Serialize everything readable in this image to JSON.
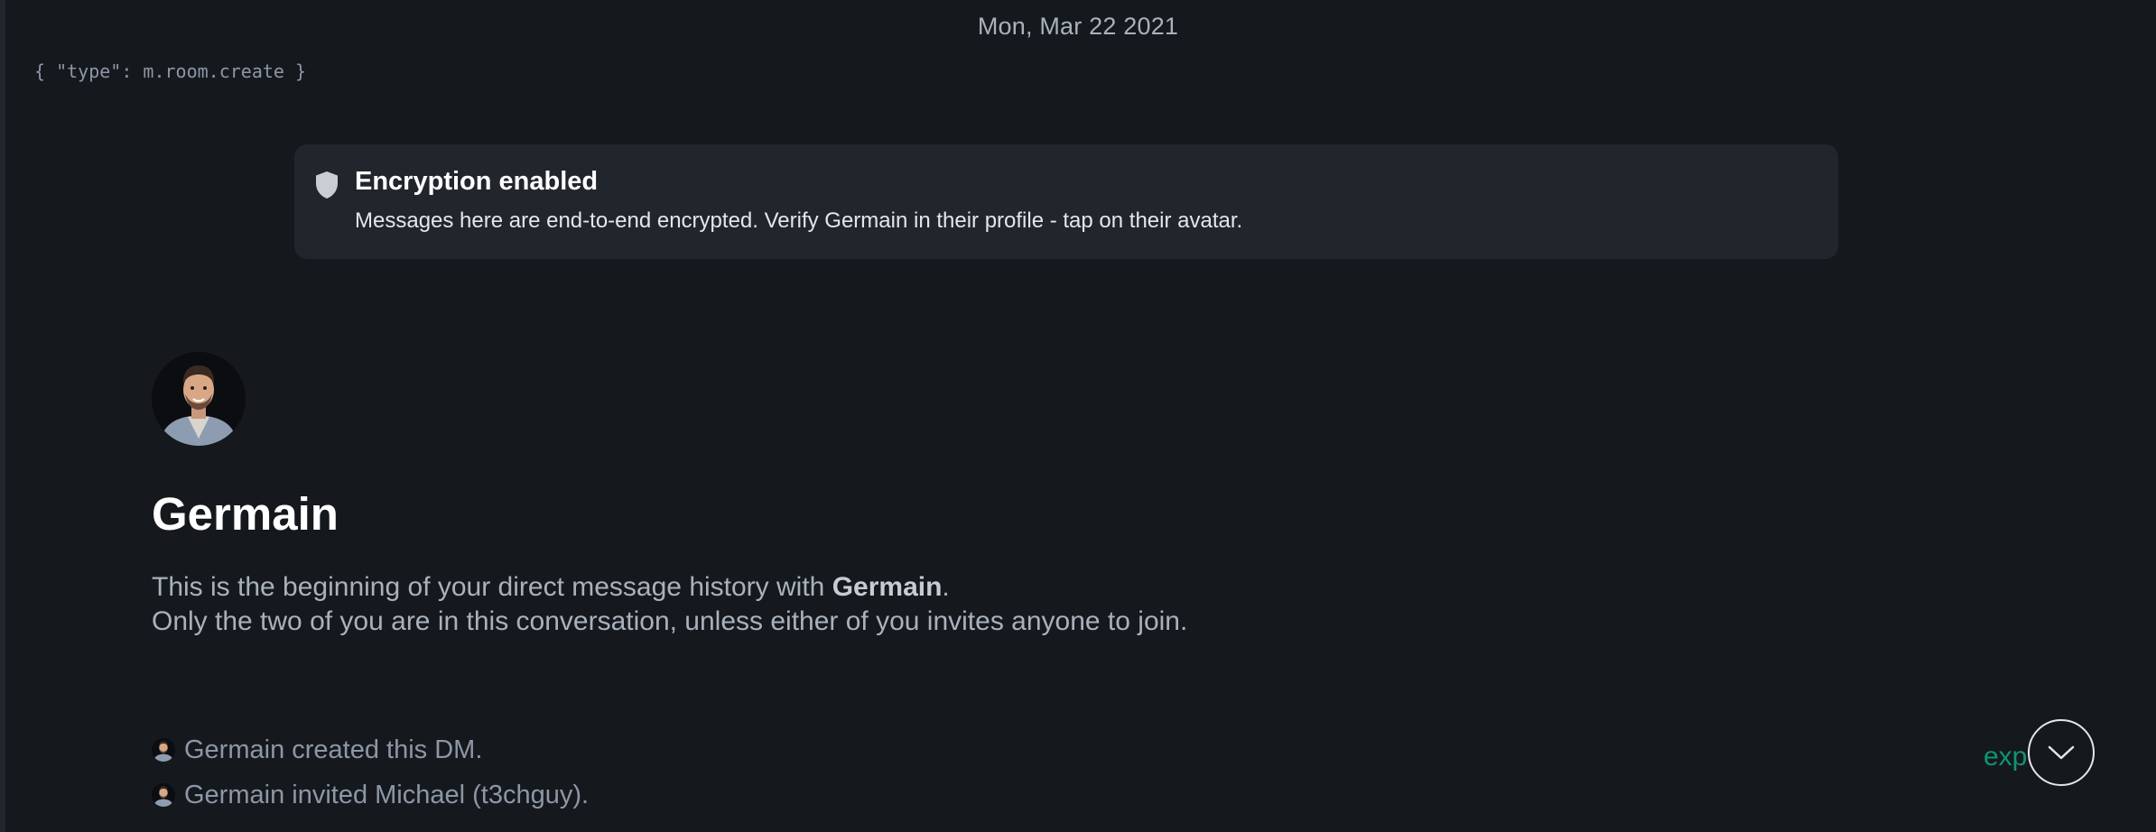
{
  "timeline": {
    "date_separator": "Mon, Mar 22 2021",
    "debug_event": "{ \"type\": m.room.create }"
  },
  "encryption_notice": {
    "icon": "shield-icon",
    "title": "Encryption enabled",
    "description": "Messages here are end-to-end encrypted. Verify Germain in their profile - tap on their avatar."
  },
  "room_intro": {
    "avatar": "user-avatar",
    "name": "Germain",
    "line1_prefix": "This is the beginning of your direct message history with ",
    "line1_name": "Germain",
    "line1_suffix": ".",
    "line2": "Only the two of you are in this conversation, unless either of you invites anyone to join."
  },
  "events": [
    {
      "text": "Germain created this DM."
    },
    {
      "text": "Germain invited Michael (t3chguy)."
    }
  ],
  "expand_label": "exp",
  "jump_button": {
    "icon": "chevron-down-icon"
  },
  "colors": {
    "background": "#15191e",
    "card": "#21262c",
    "accent": "#0dbd8b",
    "muted_text": "#a9b2bc"
  }
}
